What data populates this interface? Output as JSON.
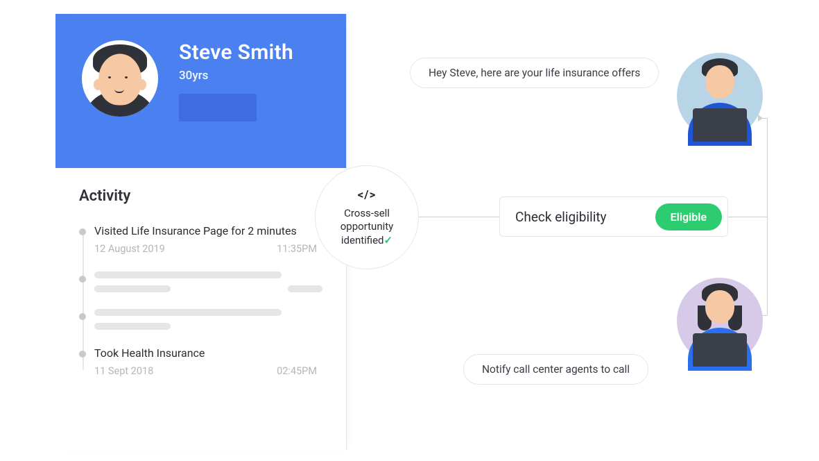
{
  "profile": {
    "name": "Steve Smith",
    "age_label": "30yrs"
  },
  "activity": {
    "section_title": "Activity",
    "items": [
      {
        "title": "Visited Life Insurance Page for 2 minutes",
        "date": "12 August 2019",
        "time": "11:35PM"
      },
      {
        "title": "Took Health Insurance",
        "date": "11 Sept 2018",
        "time": "02:45PM"
      }
    ]
  },
  "cross_sell": {
    "line1": "Cross-sell",
    "line2": "opportunity",
    "line3": "identified"
  },
  "eligibility": {
    "label": "Check eligibility",
    "status": "Eligible"
  },
  "bubbles": {
    "top": "Hey Steve, here are your life insurance offers",
    "bottom": "Notify call center agents to call"
  }
}
